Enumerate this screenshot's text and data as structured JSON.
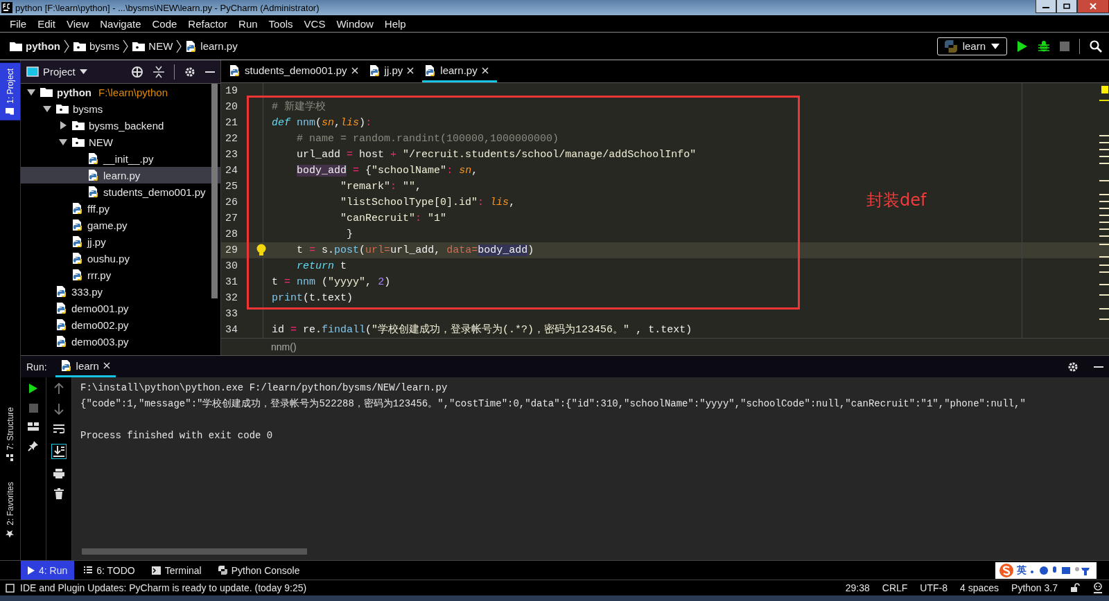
{
  "window": {
    "title": "python [F:\\learn\\python] - ...\\bysms\\NEW\\learn.py - PyCharm (Administrator)"
  },
  "menu": [
    "File",
    "Edit",
    "View",
    "Navigate",
    "Code",
    "Refactor",
    "Run",
    "Tools",
    "VCS",
    "Window",
    "Help"
  ],
  "breadcrumb": [
    {
      "label": "python",
      "kind": "root"
    },
    {
      "label": "bysms",
      "kind": "folder"
    },
    {
      "label": "NEW",
      "kind": "folder"
    },
    {
      "label": "learn.py",
      "kind": "file"
    }
  ],
  "run_config": {
    "label": "learn"
  },
  "left_strip": [
    {
      "label": "1: Project",
      "selected": true,
      "kind": "project"
    },
    {
      "label": "7: Structure",
      "selected": false,
      "kind": "structure"
    },
    {
      "label": "2: Favorites",
      "selected": false,
      "kind": "favorites"
    }
  ],
  "project_panel": {
    "view": "Project"
  },
  "project_tree": [
    {
      "label": "python",
      "path": "F:\\learn\\python",
      "kind": "root",
      "expanded": true,
      "selected": false,
      "children": [
        {
          "label": "bysms",
          "kind": "folder",
          "expanded": true,
          "selected": false,
          "children": [
            {
              "label": "bysms_backend",
              "kind": "folder",
              "expanded": false,
              "selected": false
            },
            {
              "label": "NEW",
              "kind": "folder",
              "expanded": true,
              "selected": false,
              "children": [
                {
                  "label": "__init__.py",
                  "kind": "file",
                  "selected": false
                },
                {
                  "label": "learn.py",
                  "kind": "file",
                  "selected": true
                },
                {
                  "label": "students_demo001.py",
                  "kind": "file",
                  "selected": false
                }
              ]
            },
            {
              "label": "fff.py",
              "kind": "file",
              "selected": false
            },
            {
              "label": "game.py",
              "kind": "file",
              "selected": false
            },
            {
              "label": "jj.py",
              "kind": "file",
              "selected": false
            },
            {
              "label": "oushu.py",
              "kind": "file",
              "selected": false
            },
            {
              "label": "rrr.py",
              "kind": "file",
              "selected": false
            }
          ]
        },
        {
          "label": "333.py",
          "kind": "file",
          "selected": false
        },
        {
          "label": "demo001.py",
          "kind": "file",
          "selected": false
        },
        {
          "label": "demo002.py",
          "kind": "file",
          "selected": false
        },
        {
          "label": "demo003.py",
          "kind": "file",
          "selected": false
        }
      ]
    }
  ],
  "editor_tabs": [
    {
      "label": "students_demo001.py",
      "selected": false
    },
    {
      "label": "jj.py",
      "selected": false
    },
    {
      "label": "learn.py",
      "selected": true
    }
  ],
  "code": {
    "lines_before": [
      {
        "number": "19",
        "current": false
      }
    ],
    "annotated_block": {
      "note": "封装def",
      "lines": [
        {
          "number": "20",
          "current": false,
          "tokens": [
            {
              "text": "# 新建学校",
              "kind": "comment"
            }
          ]
        },
        {
          "number": "21",
          "current": false,
          "tokens": [
            {
              "text": "def",
              "kind": "keyword"
            },
            {
              "text": " nnm",
              "kind": "function"
            },
            {
              "text": "(",
              "kind": "plain"
            },
            {
              "text": "sn",
              "kind": "param"
            },
            {
              "text": ",",
              "kind": "plain"
            },
            {
              "text": "lis",
              "kind": "param"
            },
            {
              "text": ")",
              "kind": "plain"
            },
            {
              "text": ":",
              "kind": "operator"
            }
          ]
        },
        {
          "number": "22",
          "current": false,
          "tokens": [
            {
              "text": "    # name = random.randint(100000,1000000000)",
              "kind": "comment"
            }
          ]
        },
        {
          "number": "23",
          "current": false,
          "tokens": [
            {
              "text": "    url_add ",
              "kind": "plain"
            },
            {
              "text": "=",
              "kind": "operator"
            },
            {
              "text": " host ",
              "kind": "plain"
            },
            {
              "text": "+",
              "kind": "operator"
            },
            {
              "text": " \"/recruit.students/school/manage/addSchoolInfo\"",
              "kind": "string"
            }
          ]
        },
        {
          "number": "24",
          "current": false,
          "tokens": [
            {
              "text": "    body_add",
              "kind": "highlight"
            },
            {
              "text": " =",
              "kind": "operator"
            },
            {
              "text": " {",
              "kind": "plain"
            },
            {
              "text": "\"schoolName\"",
              "kind": "string"
            },
            {
              "text": ":",
              "kind": "operator"
            },
            {
              "text": " sn",
              "kind": "param"
            },
            {
              "text": ",",
              "kind": "plain"
            }
          ]
        },
        {
          "number": "25",
          "current": false,
          "tokens": [
            {
              "text": "           \"remark\"",
              "kind": "string"
            },
            {
              "text": ":",
              "kind": "operator"
            },
            {
              "text": " \"\"",
              "kind": "string"
            },
            {
              "text": ",",
              "kind": "plain"
            }
          ]
        },
        {
          "number": "26",
          "current": false,
          "tokens": [
            {
              "text": "           \"listSchoolType[0].id\"",
              "kind": "string"
            },
            {
              "text": ":",
              "kind": "operator"
            },
            {
              "text": " lis",
              "kind": "param"
            },
            {
              "text": ",",
              "kind": "plain"
            }
          ]
        },
        {
          "number": "27",
          "current": false,
          "tokens": [
            {
              "text": "           \"canRecruit\"",
              "kind": "string"
            },
            {
              "text": ":",
              "kind": "operator"
            },
            {
              "text": " \"1\"",
              "kind": "string"
            }
          ]
        },
        {
          "number": "28",
          "current": false,
          "tokens": [
            {
              "text": "            }",
              "kind": "plain"
            }
          ]
        },
        {
          "number": "29",
          "current": true,
          "tokens": [
            {
              "text": "    t ",
              "kind": "plain"
            },
            {
              "text": "=",
              "kind": "operator"
            },
            {
              "text": " s.",
              "kind": "plain"
            },
            {
              "text": "post",
              "kind": "function"
            },
            {
              "text": "(",
              "kind": "plain"
            },
            {
              "text": "url=",
              "kind": "named_arg"
            },
            {
              "text": "url_add, ",
              "kind": "plain"
            },
            {
              "text": "data=",
              "kind": "named_arg"
            },
            {
              "text": "body_add",
              "kind": "highlight2"
            },
            {
              "text": ")",
              "kind": "plain"
            }
          ]
        },
        {
          "number": "30",
          "current": false,
          "tokens": [
            {
              "text": "    return",
              "kind": "keyword"
            },
            {
              "text": " t",
              "kind": "plain"
            }
          ]
        },
        {
          "number": "31",
          "current": false,
          "tokens": [
            {
              "text": "t ",
              "kind": "plain"
            },
            {
              "text": "=",
              "kind": "operator"
            },
            {
              "text": " nnm",
              "kind": "function"
            },
            {
              "text": " (",
              "kind": "plain"
            },
            {
              "text": "\"yyyy\"",
              "kind": "string"
            },
            {
              "text": ", ",
              "kind": "plain"
            },
            {
              "text": "2",
              "kind": "number"
            },
            {
              "text": ")",
              "kind": "plain"
            }
          ]
        },
        {
          "number": "32",
          "current": false,
          "tokens": [
            {
              "text": "print",
              "kind": "function"
            },
            {
              "text": "(t.text)",
              "kind": "plain"
            }
          ]
        }
      ]
    },
    "lines_after": [
      {
        "number": "33",
        "current": false
      },
      {
        "number": "34",
        "current": false,
        "tokens": [
          {
            "text": "id ",
            "kind": "plain"
          },
          {
            "text": "=",
            "kind": "operator"
          },
          {
            "text": " re.",
            "kind": "plain"
          },
          {
            "text": "findall",
            "kind": "function"
          },
          {
            "text": "(",
            "kind": "plain"
          },
          {
            "text": "\"学校创建成功，登录帐号为(.*?)，密码为123456。\"",
            "kind": "string"
          },
          {
            "text": " , t.text)",
            "kind": "plain"
          }
        ]
      }
    ]
  },
  "editor_breadcrumb": "nnm()",
  "run_panel": {
    "label": "Run:",
    "tab": "learn",
    "output": [
      {
        "text": "F:\\install\\python\\python.exe F:/learn/python/bysms/NEW/learn.py",
        "kind": "command"
      },
      {
        "text": "{\"code\":1,\"message\":\"学校创建成功，登录帐号为522288，密码为123456。\",\"costTime\":0,\"data\":{\"id\":310,\"schoolName\":\"yyyy\",\"schoolCode\":null,\"canRecruit\":\"1\",\"phone\":null,\"",
        "kind": "stdout"
      },
      {
        "text": "Process finished with exit code 0",
        "kind": "exit"
      }
    ]
  },
  "bottom_tabs": [
    {
      "label": "4: Run",
      "kind": "run",
      "selected": true
    },
    {
      "label": "6: TODO",
      "kind": "todo",
      "selected": false
    },
    {
      "label": "Terminal",
      "kind": "terminal",
      "selected": false
    },
    {
      "label": "Python Console",
      "kind": "console",
      "selected": false
    }
  ],
  "ime_toolbar": {
    "label": "英"
  },
  "status_bar": {
    "message": "IDE and Plugin Updates: PyCharm is ready to update. (today 9:25)",
    "items": [
      "29:38",
      "CRLF",
      "UTF-8",
      "4 spaces",
      "Python 3.7"
    ]
  }
}
